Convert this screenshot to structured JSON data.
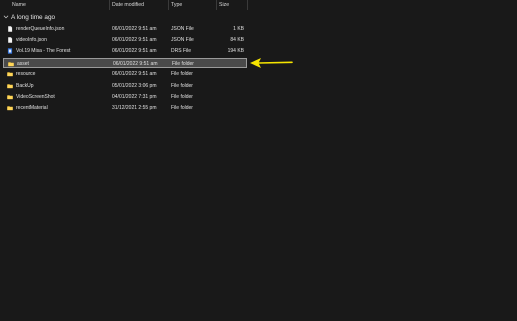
{
  "columns": {
    "name": "Name",
    "date_modified": "Date modified",
    "type": "Type",
    "size": "Size"
  },
  "group": {
    "label": "A long time ago"
  },
  "rows": [
    {
      "name": "renderQueueInfo.json",
      "date": "06/01/2022 9:51 am",
      "type": "JSON File",
      "size": "1 KB",
      "icon": "file-icon"
    },
    {
      "name": "videoInfo.json",
      "date": "06/01/2022 9:51 am",
      "type": "JSON File",
      "size": "84 KB",
      "icon": "file-icon"
    },
    {
      "name": "Vol.19 Misa - The Forest",
      "date": "06/01/2022 9:51 am",
      "type": "DRS File",
      "size": "194 KB",
      "icon": "drs-file-icon"
    },
    {
      "name": "asset",
      "date": "06/01/2022 9:51 am",
      "type": "File folder",
      "size": "",
      "icon": "folder-icon"
    },
    {
      "name": "resource",
      "date": "06/01/2022 9:51 am",
      "type": "File folder",
      "size": "",
      "icon": "folder-icon"
    },
    {
      "name": "BackUp",
      "date": "05/01/2022 3:06 pm",
      "type": "File folder",
      "size": "",
      "icon": "folder-icon"
    },
    {
      "name": "VideoScreenShot",
      "date": "04/01/2022 7:31 pm",
      "type": "File folder",
      "size": "",
      "icon": "folder-icon"
    },
    {
      "name": "recentMaterial",
      "date": "31/12/2021 2:55 pm",
      "type": "File folder",
      "size": "",
      "icon": "folder-icon"
    }
  ],
  "selected_row": "asset",
  "colors": {
    "background": "#191919",
    "folder": "#f0c43c",
    "arrow": "#f5e400",
    "selection": "#4a4a4a"
  }
}
